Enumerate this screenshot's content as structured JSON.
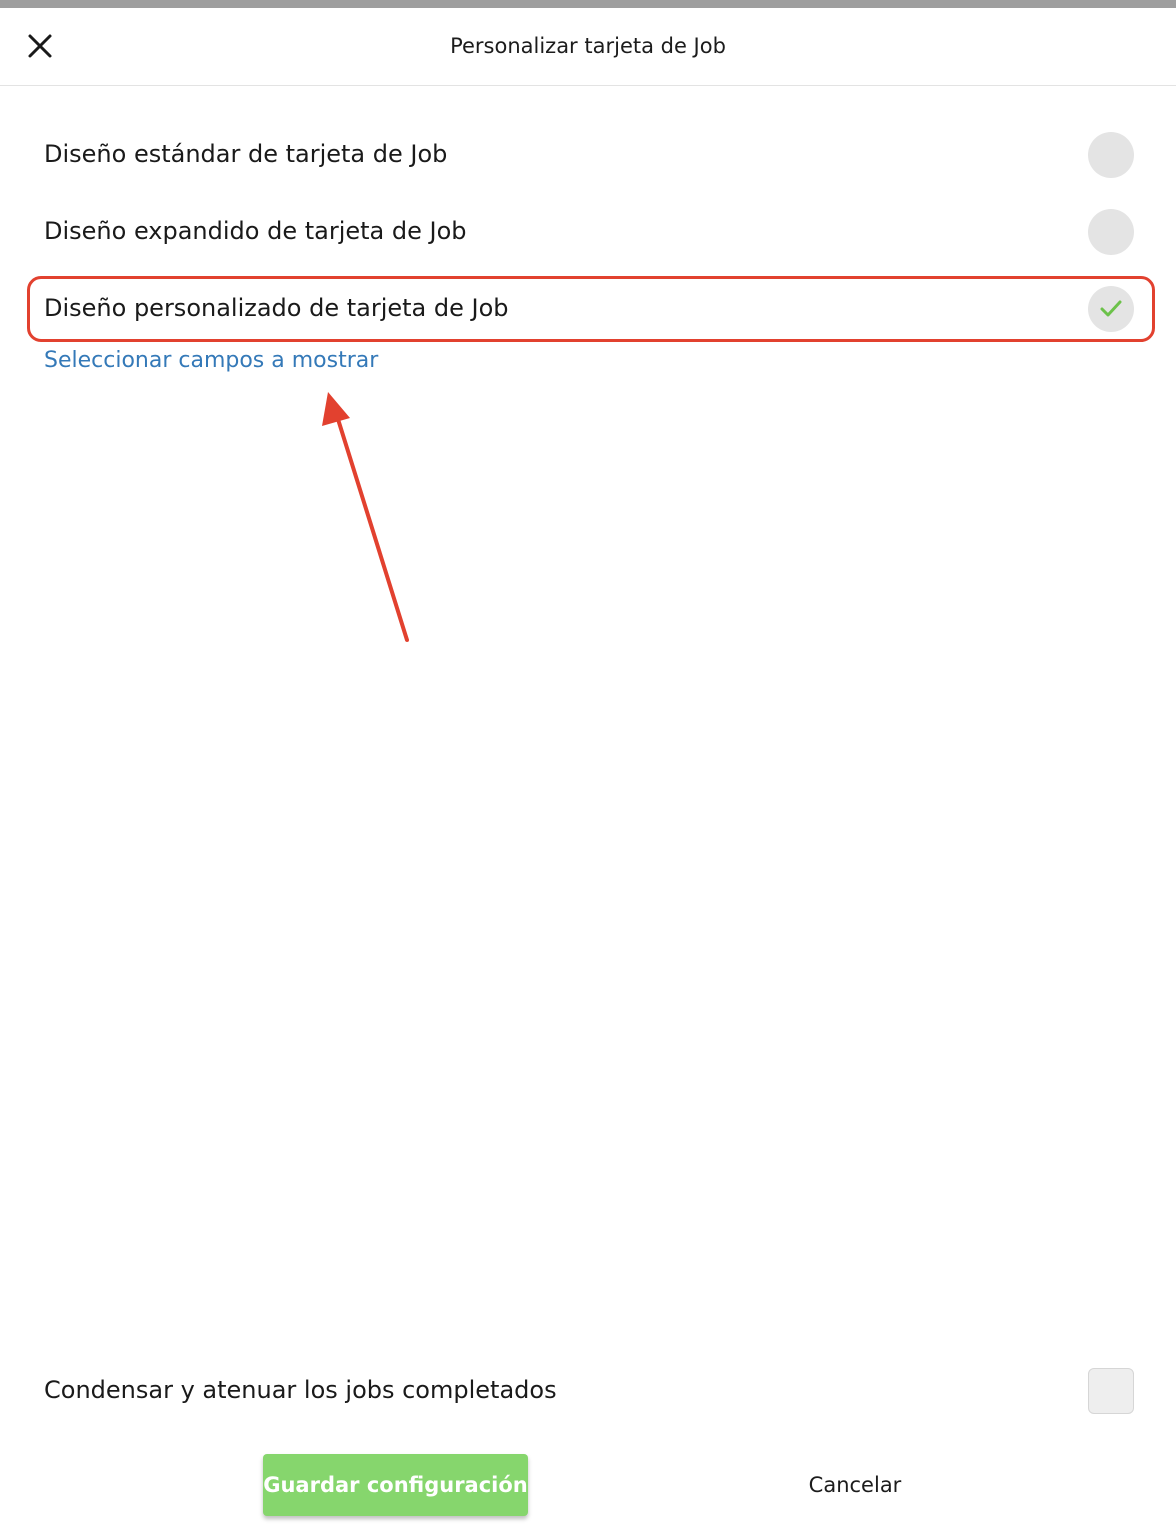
{
  "header": {
    "title": "Personalizar tarjeta de Job",
    "close_icon": "close-icon"
  },
  "options": [
    {
      "label": "Diseño estándar de tarjeta de Job",
      "selected": false
    },
    {
      "label": "Diseño expandido de tarjeta de Job",
      "selected": false
    },
    {
      "label": "Diseño personalizado de tarjeta de Job",
      "selected": true
    }
  ],
  "custom_fields_link": "Seleccionar campos a mostrar",
  "condense": {
    "label": "Condensar y atenuar los jobs completados",
    "checked": false
  },
  "footer": {
    "save_label": "Guardar configuración",
    "cancel_label": "Cancelar"
  },
  "colors": {
    "accent_green": "#86d66d",
    "check_green": "#6cc24a",
    "link_blue": "#3479b8",
    "annotation_red": "#e2412f"
  }
}
